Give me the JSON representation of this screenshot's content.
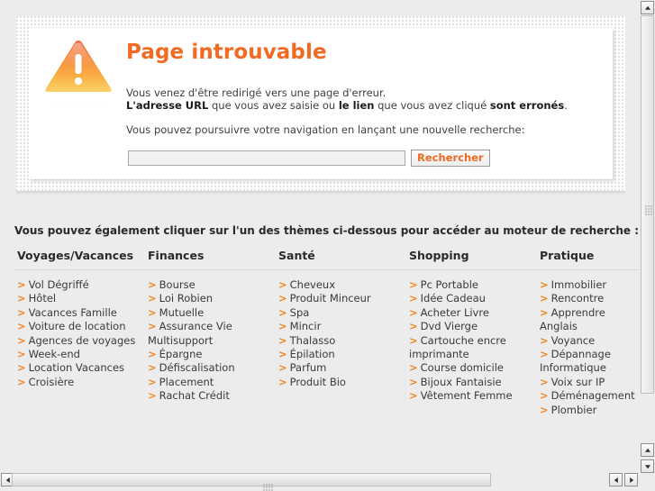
{
  "error_panel": {
    "icon": "warning-triangle-icon",
    "title": "Page introuvable",
    "line1": "Vous venez d'être redirigé vers une page d'erreur.",
    "line2_bold1": "L'adresse URL",
    "line2_mid1": " que vous avez saisie ou ",
    "line2_bold2": "le lien",
    "line2_mid2": " que vous avez cliqué ",
    "line2_bold3": "sont erronés",
    "line2_end": ".",
    "line3": "Vous pouvez poursuivre votre navigation en lançant une nouvelle recherche:",
    "search_value": "",
    "search_placeholder": "",
    "search_button": "Rechercher"
  },
  "themes": {
    "heading": "Vous pouvez également cliquer sur l'un des thèmes ci-dessous pour accéder au moteur de recherche :",
    "arrow_marker": ">",
    "columns": [
      {
        "title": "Voyages/Vacances",
        "links": [
          "Vol Dégriffé",
          "Hôtel",
          "Vacances Famille",
          "Voiture de location",
          "Agences de voyages",
          "Week-end",
          "Location Vacances",
          "Croisière"
        ]
      },
      {
        "title": "Finances",
        "links": [
          "Bourse",
          "Loi Robien",
          "Mutuelle",
          "Assurance Vie Multisupport",
          "Épargne",
          "Défiscalisation",
          "Placement",
          "Rachat Crédit"
        ]
      },
      {
        "title": "Santé",
        "links": [
          "Cheveux",
          "Produit Minceur",
          "Spa",
          "Mincir",
          "Thalasso",
          "Épilation",
          "Parfum",
          "Produit Bio"
        ]
      },
      {
        "title": "Shopping",
        "links": [
          "Pc Portable",
          "Idée Cadeau",
          "Acheter Livre",
          "Dvd Vierge",
          "Cartouche encre imprimante",
          "Course domicile",
          "Bijoux Fantaisie",
          "Vêtement Femme"
        ]
      },
      {
        "title": "Pratique",
        "links": [
          "Immobilier",
          "Rencontre",
          "Apprendre Anglais",
          "Voyance",
          "Dépannage Informatique",
          "Voix sur IP",
          "Déménagement",
          "Plombier"
        ]
      }
    ]
  },
  "colors": {
    "accent_orange": "#f26a21",
    "marker_orange": "#f58220",
    "page_background": "#ececec",
    "panel_background": "#ffffff",
    "text_dark": "#2a2a2a"
  }
}
